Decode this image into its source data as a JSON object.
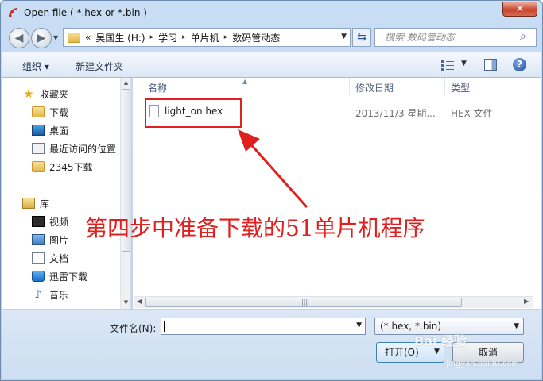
{
  "window": {
    "title": "Open file ( *.hex or *.bin )",
    "close_label": "✕"
  },
  "address": {
    "prefix": "«",
    "parts": [
      "吴国生 (H:)",
      "学习",
      "单片机",
      "数码管动态"
    ],
    "separator": "▸"
  },
  "search": {
    "placeholder": "搜索 数码管动态"
  },
  "toolbar": {
    "organize_label": "组织 ▾",
    "new_folder_label": "新建文件夹"
  },
  "sidebar": {
    "items": [
      {
        "label": "收藏夹",
        "icon": "star-icon"
      },
      {
        "label": "下载",
        "icon": "folder-icon"
      },
      {
        "label": "桌面",
        "icon": "desktop-icon"
      },
      {
        "label": "最近访问的位置",
        "icon": "recent-places-icon"
      },
      {
        "label": "2345下载",
        "icon": "folder-icon"
      },
      {
        "label": "库",
        "icon": "library-icon"
      },
      {
        "label": "视频",
        "icon": "video-icon"
      },
      {
        "label": "图片",
        "icon": "pictures-icon"
      },
      {
        "label": "文档",
        "icon": "documents-icon"
      },
      {
        "label": "迅雷下载",
        "icon": "thunder-download-icon"
      },
      {
        "label": "音乐",
        "icon": "music-icon"
      }
    ]
  },
  "columns": {
    "name": "名称",
    "modified": "修改日期",
    "type": "类型"
  },
  "files": [
    {
      "name": "light_on.hex",
      "modified": "2013/11/3 星期...",
      "type": "HEX 文件"
    }
  ],
  "annotation": {
    "text": "第四步中准备下载的51单片机程序",
    "color": "#e0201e"
  },
  "bottom": {
    "filename_label": "文件名(N):",
    "filename_value": "",
    "filter_value": "(*.hex, *.bin)",
    "open_label": "打开(O)",
    "cancel_label": "取消"
  },
  "watermark": {
    "text": "Bai 经验",
    "sub": "jingyan.baidu.com"
  },
  "colors": {
    "highlight": "#e0201e",
    "window_frame": "#c9def5"
  }
}
